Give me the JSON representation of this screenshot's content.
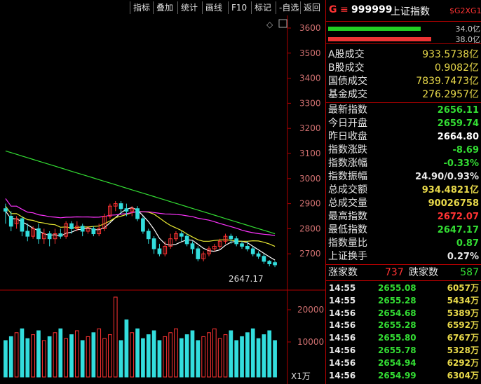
{
  "toolbar": {
    "buttons": [
      "指标",
      "叠加",
      "统计",
      "画线",
      "F10",
      "标记",
      "-自选",
      "返回"
    ]
  },
  "header": {
    "g_label": "G",
    "menu_glyph": "≡",
    "code": "999999",
    "name": "上证指数",
    "tag": "$G2XG1"
  },
  "volume_bars": {
    "up_value": "34.0亿",
    "down_value": "38.0亿",
    "up_fraction": 0.6,
    "down_fraction": 0.67
  },
  "turnover": [
    {
      "label": "A股成交",
      "value": "933.5738亿"
    },
    {
      "label": "B股成交",
      "value": "0.9082亿"
    },
    {
      "label": "国债成交",
      "value": "7839.7473亿"
    },
    {
      "label": "基金成交",
      "value": "276.2957亿"
    }
  ],
  "stats": [
    {
      "label": "最新指数",
      "value": "2656.11",
      "color": "#33dd33"
    },
    {
      "label": "今日开盘",
      "value": "2659.74",
      "color": "#33dd33"
    },
    {
      "label": "昨日收盘",
      "value": "2664.80",
      "color": "#ffffff"
    },
    {
      "label": "指数涨跌",
      "value": "-8.69",
      "color": "#33dd33"
    },
    {
      "label": "指数涨幅",
      "value": "-0.33%",
      "color": "#33dd33"
    },
    {
      "label": "指数振幅",
      "value": "24.90/0.93%",
      "color": "#e8e8e8"
    },
    {
      "label": "总成交额",
      "value": "934.4821亿",
      "color": "#e8d94a"
    },
    {
      "label": "总成交量",
      "value": "90026758",
      "color": "#e8d94a"
    },
    {
      "label": "最高指数",
      "value": "2672.07",
      "color": "#ff3333"
    },
    {
      "label": "最低指数",
      "value": "2647.17",
      "color": "#33dd33"
    },
    {
      "label": "指数量比",
      "value": "0.87",
      "color": "#33dd33"
    },
    {
      "label": "上证换手",
      "value": "0.27%",
      "color": "#e8e8e8"
    }
  ],
  "breadth": {
    "up_label": "涨家数",
    "up_value": "737",
    "down_label": "跌家数",
    "down_value": "587"
  },
  "ticks": [
    {
      "time": "14:55",
      "price": "2655.08",
      "vol": "6057万"
    },
    {
      "time": "14:55",
      "price": "2655.28",
      "vol": "5434万"
    },
    {
      "time": "14:56",
      "price": "2654.68",
      "vol": "5389万"
    },
    {
      "time": "14:56",
      "price": "2655.28",
      "vol": "6592万"
    },
    {
      "time": "14:56",
      "price": "2655.80",
      "vol": "6767万"
    },
    {
      "time": "14:56",
      "price": "2655.78",
      "vol": "5328万"
    },
    {
      "time": "14:56",
      "price": "2654.94",
      "vol": "6292万"
    },
    {
      "time": "14:56",
      "price": "2654.99",
      "vol": "6304万"
    }
  ],
  "chart": {
    "price_ticks": [
      "3600",
      "3500",
      "3400",
      "3300",
      "3200",
      "3100",
      "3000",
      "2900",
      "2800",
      "2700"
    ],
    "volume_ticks": [
      "20000",
      "10000"
    ],
    "low_annotation": "2647.17",
    "volume_unit": "X1万",
    "up_color": "#ff3333",
    "down_color": "#33dddd",
    "ma_colors": [
      "#ffffff",
      "#e8e833",
      "#ff33ff",
      "#33dd33"
    ]
  },
  "chart_data": {
    "type": "candlestick",
    "price_axis": {
      "min": 2600,
      "max": 3600
    },
    "candles": [
      [
        2880,
        2870,
        2900,
        2820,
        1
      ],
      [
        2850,
        2810,
        2870,
        2790,
        1
      ],
      [
        2820,
        2840,
        2850,
        2800,
        1
      ],
      [
        2840,
        2790,
        2850,
        2770,
        1
      ],
      [
        2790,
        2770,
        2820,
        2750,
        1
      ],
      [
        2770,
        2800,
        2810,
        2760,
        1
      ],
      [
        2800,
        2760,
        2820,
        2740,
        1
      ],
      [
        2760,
        2780,
        2800,
        2740,
        1
      ],
      [
        2780,
        2760,
        2790,
        2730,
        1
      ],
      [
        2760,
        2780,
        2800,
        2740,
        1
      ],
      [
        2780,
        2770,
        2800,
        2760,
        1
      ],
      [
        2770,
        2820,
        2830,
        2760,
        1
      ],
      [
        2820,
        2800,
        2830,
        2780,
        1
      ],
      [
        2800,
        2810,
        2830,
        2790,
        1
      ],
      [
        2810,
        2790,
        2820,
        2770,
        1
      ],
      [
        2790,
        2800,
        2810,
        2780,
        1
      ],
      [
        2800,
        2780,
        2810,
        2770,
        1
      ],
      [
        2780,
        2800,
        2820,
        2770,
        1
      ],
      [
        2800,
        2850,
        2860,
        2790,
        1
      ],
      [
        2850,
        2890,
        2900,
        2840,
        1
      ],
      [
        2890,
        2900,
        2910,
        2870,
        1
      ],
      [
        2900,
        2880,
        2910,
        2860,
        1
      ],
      [
        2880,
        2870,
        2900,
        2850,
        1
      ],
      [
        2870,
        2880,
        2890,
        2850,
        1
      ],
      [
        2880,
        2840,
        2890,
        2830,
        1
      ],
      [
        2840,
        2790,
        2850,
        2780,
        1
      ],
      [
        2790,
        2760,
        2800,
        2740,
        1
      ],
      [
        2760,
        2720,
        2770,
        2700,
        1
      ],
      [
        2720,
        2700,
        2740,
        2690,
        1
      ],
      [
        2700,
        2730,
        2750,
        2690,
        1
      ],
      [
        2730,
        2760,
        2780,
        2720,
        1
      ],
      [
        2760,
        2780,
        2790,
        2750,
        1
      ],
      [
        2780,
        2770,
        2790,
        2750,
        1
      ],
      [
        2770,
        2740,
        2780,
        2730,
        1
      ],
      [
        2740,
        2720,
        2750,
        2700,
        1
      ],
      [
        2720,
        2680,
        2730,
        2670,
        1
      ],
      [
        2680,
        2700,
        2710,
        2670,
        1
      ],
      [
        2700,
        2720,
        2730,
        2690,
        1
      ],
      [
        2720,
        2730,
        2740,
        2710,
        1
      ],
      [
        2730,
        2750,
        2760,
        2720,
        1
      ],
      [
        2750,
        2770,
        2780,
        2740,
        1
      ],
      [
        2770,
        2760,
        2780,
        2740,
        1
      ],
      [
        2760,
        2740,
        2770,
        2730,
        1
      ],
      [
        2740,
        2730,
        2750,
        2720,
        1
      ],
      [
        2730,
        2720,
        2750,
        2710,
        1
      ],
      [
        2720,
        2700,
        2730,
        2690,
        1
      ],
      [
        2700,
        2690,
        2710,
        2680,
        1
      ],
      [
        2690,
        2670,
        2700,
        2660,
        1
      ],
      [
        2670,
        2660,
        2675,
        2650,
        1
      ],
      [
        2665,
        2656,
        2672,
        2647,
        1
      ]
    ]
  }
}
